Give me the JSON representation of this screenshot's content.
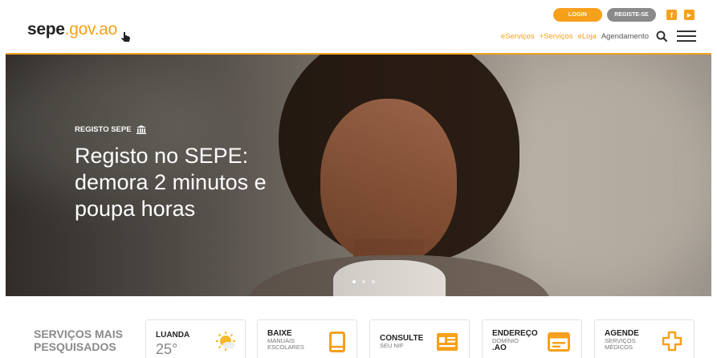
{
  "header": {
    "logo": {
      "main": "sepe",
      "suffix": ".gov.ao"
    },
    "login_label": "LOGIN",
    "register_label": "REGISTE-SE",
    "social": {
      "facebook": "f",
      "youtube": "▶"
    },
    "nav": [
      "eServiços",
      "+Serviços",
      "eLoja",
      "Agendamento"
    ]
  },
  "hero": {
    "kicker": "REGISTO SEPE",
    "title": "Registo no SEPE: demora 2 minutos e poupa horas",
    "slides": 3,
    "active_slide": 1
  },
  "services": {
    "heading": "SERVIÇOS MAIS PESQUISADOS",
    "cards": [
      {
        "label": "LUANDA",
        "value": "25°",
        "icon": "weather-sun-icon"
      },
      {
        "label": "BAIXE",
        "sub": "MANUAIS ESCOLARES",
        "icon": "tablet-icon"
      },
      {
        "label": "CONSULTE",
        "sub": "SEU NIF",
        "icon": "id-card-icon"
      },
      {
        "label": "ENDEREÇO",
        "sub": "DOMÍNIO",
        "extra": ".AO",
        "icon": "browser-window-icon"
      },
      {
        "label": "AGENDE",
        "sub": "SERVIÇOS MÉDICOS",
        "icon": "medical-cross-icon"
      }
    ]
  },
  "colors": {
    "accent": "#f7a01b",
    "grey_button": "#8a8a8a",
    "text_dark": "#222222"
  }
}
